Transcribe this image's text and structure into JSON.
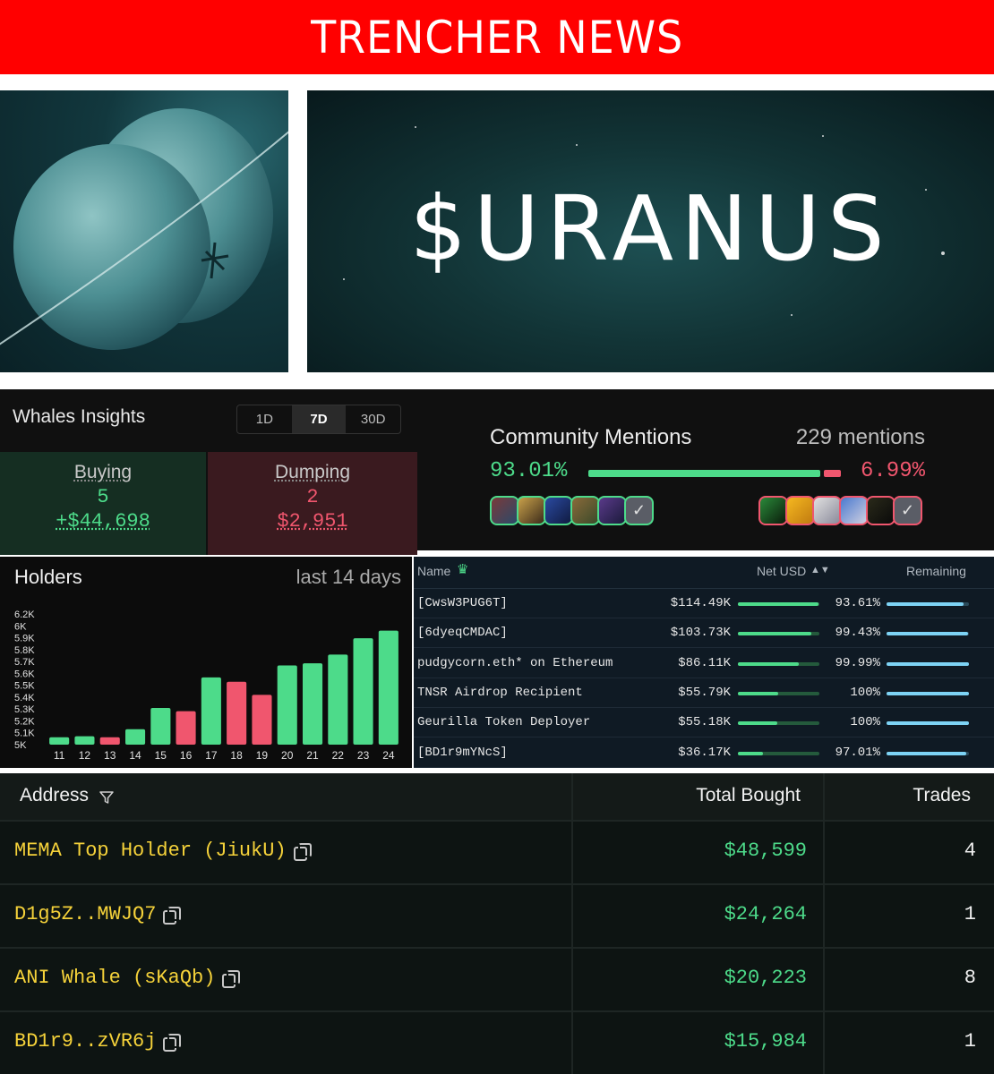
{
  "banner": {
    "title": "TRENCHER NEWS"
  },
  "hero": {
    "title": "$URANUS"
  },
  "whales": {
    "title": "Whales Insights",
    "tabs": [
      "1D",
      "7D",
      "30D"
    ],
    "active_tab": "7D",
    "buying": {
      "label": "Buying",
      "count": "5",
      "amount": "+$44,698"
    },
    "dumping": {
      "label": "Dumping",
      "count": "2",
      "amount": "$2,951"
    }
  },
  "community": {
    "title": "Community Mentions",
    "mentions": "229 mentions",
    "positive_pct": "93.01%",
    "negative_pct": "6.99%",
    "positive_fraction": 0.9301,
    "colors": {
      "positive": "#4ddb8a",
      "negative": "#f0566e"
    }
  },
  "holders": {
    "title": "Holders",
    "subtitle": "last 14 days"
  },
  "chart_data": {
    "type": "bar",
    "categories": [
      "11",
      "12",
      "13",
      "14",
      "15",
      "16",
      "17",
      "18",
      "19",
      "20",
      "21",
      "22",
      "23",
      "24"
    ],
    "values": [
      5100,
      5110,
      5100,
      5175,
      5370,
      5340,
      5650,
      5610,
      5490,
      5760,
      5780,
      5860,
      6010,
      6080
    ],
    "change": [
      "up",
      "up",
      "down",
      "up",
      "up",
      "down",
      "up",
      "down",
      "down",
      "up",
      "up",
      "up",
      "up",
      "up"
    ],
    "yticks": [
      "5K",
      "5.1K",
      "5.2K",
      "5.3K",
      "5.4K",
      "5.5K",
      "5.6K",
      "5.7K",
      "5.8K",
      "5.9K",
      "6K",
      "6.2K"
    ],
    "ylim": [
      5000,
      6200
    ],
    "colors": {
      "up": "#4ddb8a",
      "down": "#f0566e"
    }
  },
  "top_holders": {
    "headers": {
      "name": "Name",
      "net_usd": "Net USD",
      "remaining": "Remaining"
    },
    "rows": [
      {
        "name": "[CwsW3PUG6T]",
        "net_usd": "$114.49K",
        "net_fraction": 0.99,
        "remaining": "93.61%",
        "remaining_fraction": 0.9361
      },
      {
        "name": "[6dyeqCMDAC]",
        "net_usd": "$103.73K",
        "net_fraction": 0.9,
        "remaining": "99.43%",
        "remaining_fraction": 0.9943
      },
      {
        "name": "pudgycorn.eth* on Ethereum",
        "net_usd": "$86.11K",
        "net_fraction": 0.75,
        "remaining": "99.99%",
        "remaining_fraction": 0.9999
      },
      {
        "name": "TNSR Airdrop Recipient",
        "net_usd": "$55.79K",
        "net_fraction": 0.49,
        "remaining": "100%",
        "remaining_fraction": 1.0
      },
      {
        "name": "Geurilla Token Deployer",
        "net_usd": "$55.18K",
        "net_fraction": 0.48,
        "remaining": "100%",
        "remaining_fraction": 1.0
      },
      {
        "name": "[BD1r9mYNcS]",
        "net_usd": "$36.17K",
        "net_fraction": 0.31,
        "remaining": "97.01%",
        "remaining_fraction": 0.9701
      }
    ]
  },
  "buyers": {
    "headers": {
      "address": "Address",
      "total_bought": "Total Bought",
      "trades": "Trades"
    },
    "rows": [
      {
        "address": "MEMA Top Holder (JiukU)",
        "total_bought": "$48,599",
        "trades": "4"
      },
      {
        "address": "D1g5Z..MWJQ7",
        "total_bought": "$24,264",
        "trades": "1"
      },
      {
        "address": "ANI Whale (sKaQb)",
        "total_bought": "$20,223",
        "trades": "8"
      },
      {
        "address": "BD1r9..zVR6j",
        "total_bought": "$15,984",
        "trades": "1"
      }
    ]
  }
}
